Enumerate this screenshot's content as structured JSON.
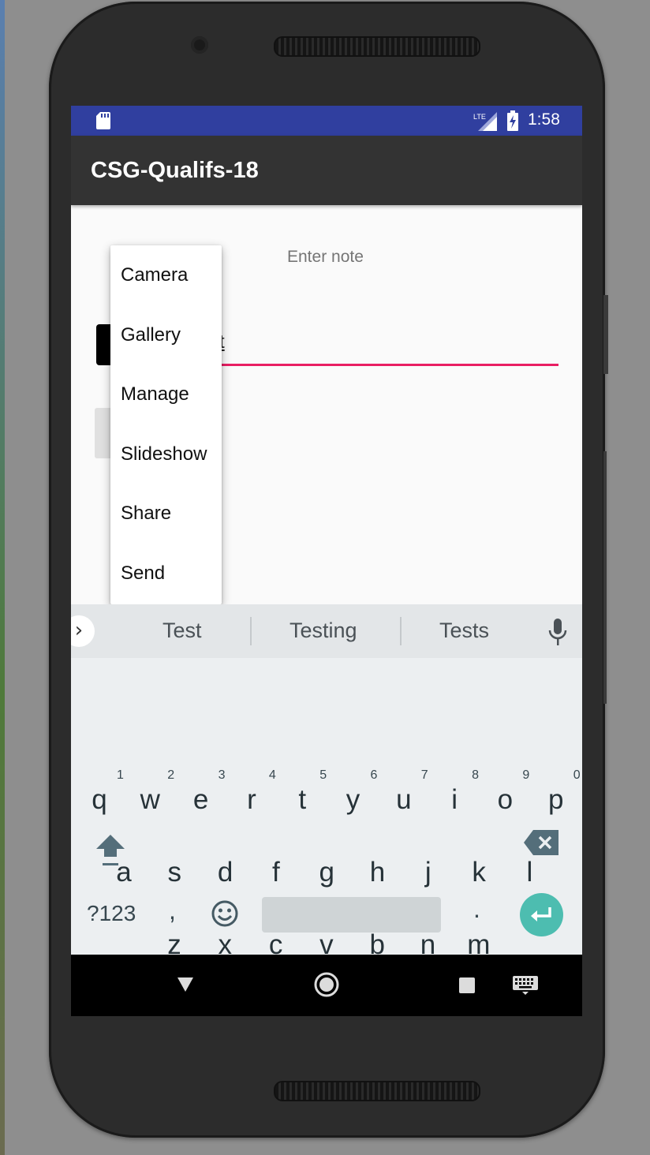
{
  "status_bar": {
    "time": "1:58",
    "network": "LTE",
    "icons": [
      "sd-card-icon",
      "lte-signal-icon",
      "battery-charging-icon"
    ]
  },
  "app": {
    "title": "CSG-Qualifs-18"
  },
  "form": {
    "note_label": "Enter note",
    "input_value": "t"
  },
  "popup_menu": {
    "items": [
      "Camera",
      "Gallery",
      "Manage",
      "Slideshow",
      "Share",
      "Send"
    ]
  },
  "keyboard": {
    "suggestions": [
      "Test",
      "Testing",
      "Tests"
    ],
    "row1": [
      "q",
      "w",
      "e",
      "r",
      "t",
      "y",
      "u",
      "i",
      "o",
      "p"
    ],
    "row1_hints": [
      "1",
      "2",
      "3",
      "4",
      "5",
      "6",
      "7",
      "8",
      "9",
      "0"
    ],
    "row2": [
      "a",
      "s",
      "d",
      "f",
      "g",
      "h",
      "j",
      "k",
      "l"
    ],
    "row3": [
      "z",
      "x",
      "c",
      "v",
      "b",
      "n",
      "m"
    ],
    "symbols_label": "?123",
    "comma": ",",
    "period": "."
  },
  "colors": {
    "status_bar": "#303f9f",
    "app_bar": "#333333",
    "accent": "#e91e63",
    "enter_key": "#4dbdb0"
  }
}
